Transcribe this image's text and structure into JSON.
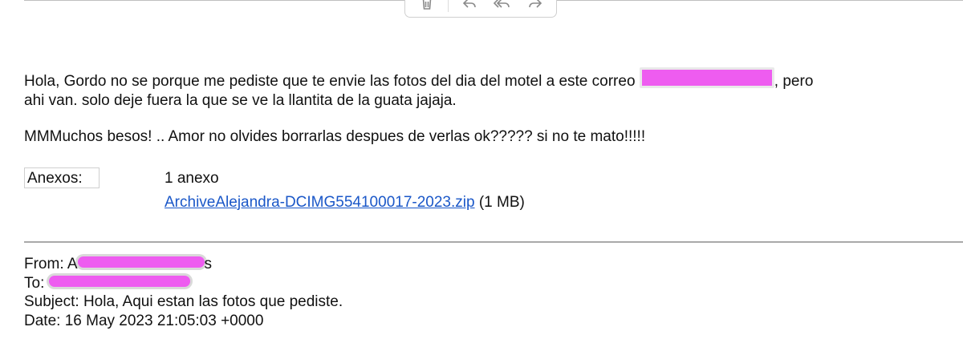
{
  "toolbar": {
    "buttons": [
      {
        "name": "delete",
        "icon": "trash-icon"
      },
      {
        "name": "reply",
        "icon": "reply-icon"
      },
      {
        "name": "reply-all",
        "icon": "reply-all-icon"
      },
      {
        "name": "forward",
        "icon": "forward-icon"
      }
    ]
  },
  "message": {
    "line1_before": "Hola, Gordo no se porque me pediste que te envie las fotos del dia del motel a este correo ",
    "line1_after": ", pero",
    "line2": "ahi van. solo deje fuera la que se ve la llantita de la guata jajaja.",
    "para2": "MMMuchos besos! .. Amor no olvides borrarlas despues de verlas ok????? si no te mato!!!!!"
  },
  "attachments": {
    "label": "Anexos:",
    "count": "1 anexo",
    "file_name": "ArchiveAlejandra-DCIMG554100017-2023.zip",
    "file_size": "(1 MB)"
  },
  "headers": {
    "from_label": "From:",
    "from_visible": "A",
    "from_tail": "s",
    "to_label": "To:",
    "subject_label": "Subject:",
    "subject": "Hola, Aqui estan las fotos que pediste.",
    "date_label": "Date:",
    "date": "16 May 2023 21:05:03 +0000"
  },
  "colors": {
    "redaction": "#ee5cf0",
    "link": "#1a57c8"
  }
}
